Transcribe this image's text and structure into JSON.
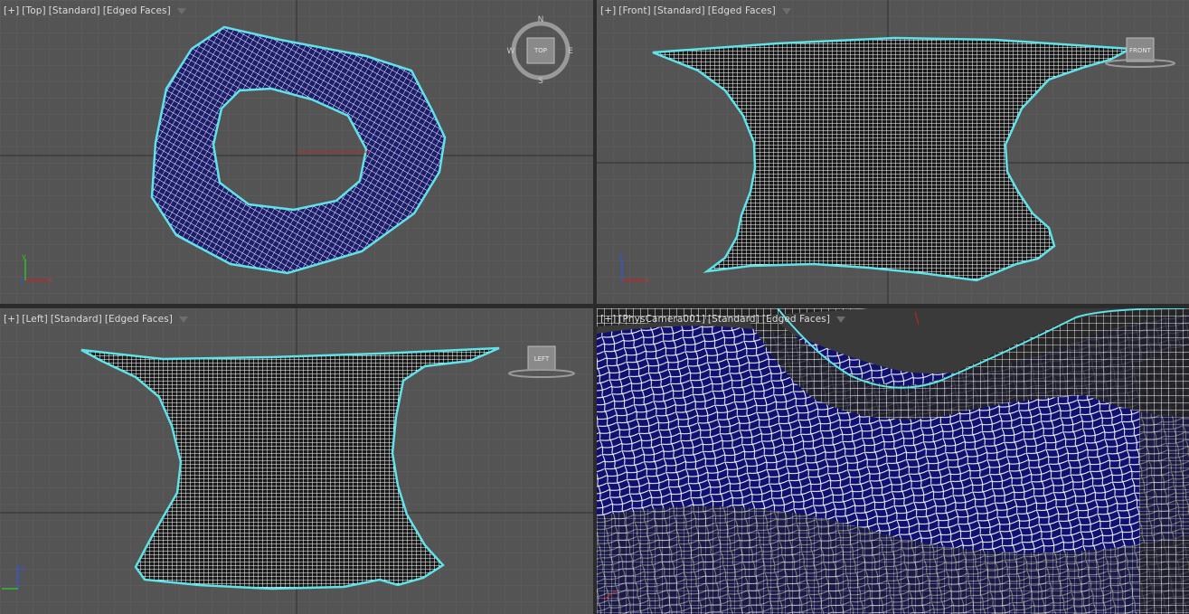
{
  "viewports": {
    "top": {
      "plus": "[+]",
      "view": "[Top]",
      "shading": "[Standard]",
      "mode": "[Edged Faces]",
      "cube_label": "TOP",
      "compass": {
        "n": "N",
        "s": "S",
        "e": "E",
        "w": "W"
      }
    },
    "front": {
      "plus": "[+]",
      "view": "[Front]",
      "shading": "[Standard]",
      "mode": "[Edged Faces]",
      "cube_label": "FRONT"
    },
    "left": {
      "plus": "[+]",
      "view": "[Left]",
      "shading": "[Standard]",
      "mode": "[Edged Faces]",
      "cube_label": "LEFT"
    },
    "camera": {
      "plus": "[+]",
      "view": "[PhysCamera001]",
      "shading": "[Standard]",
      "mode": "[Edged Faces]"
    }
  },
  "axes": {
    "x": "x",
    "y": "y",
    "z": "z"
  },
  "colors": {
    "bg": "#545454",
    "grid": "#5f5f5f",
    "gridMajor": "#3e3e3e",
    "mesh": "#ffffff",
    "meshFill": "#1c1c6c",
    "selection": "#5fe3e8",
    "activeBorder": "#8a7a3c"
  }
}
